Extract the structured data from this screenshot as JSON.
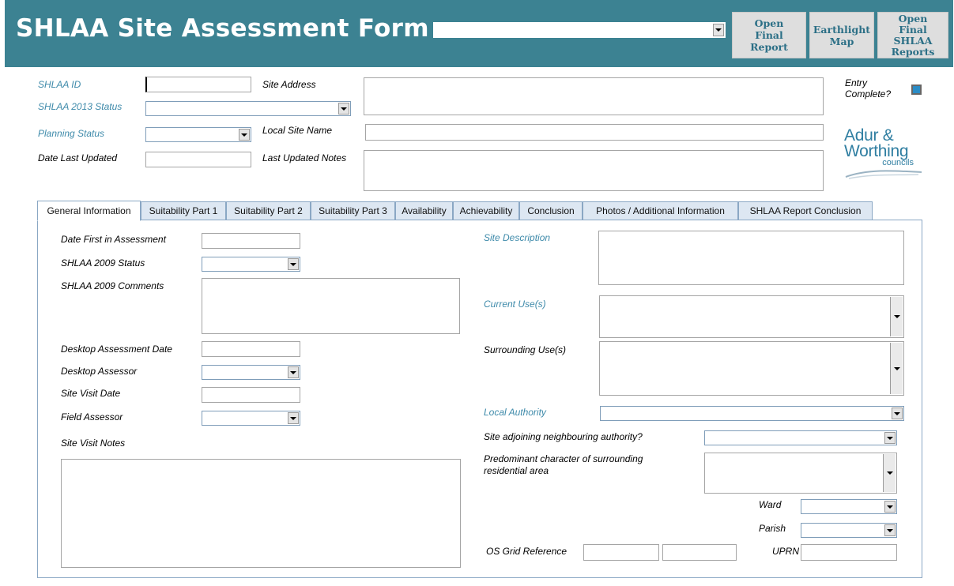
{
  "header": {
    "title": "SHLAA Site Assessment Form",
    "site_select_value": "",
    "buttons": {
      "open_final_report": "Open Final Report",
      "earthlight_map": "Earthlight Map",
      "open_final_shlaa_reports": "Open Final SHLAA Reports"
    }
  },
  "top_form": {
    "shlaa_id_label": "SHLAA ID",
    "shlaa_2013_status_label": "SHLAA 2013 Status",
    "planning_status_label": "Planning Status",
    "date_last_updated_label": "Date Last Updated",
    "site_address_label": "Site Address",
    "local_site_name_label": "Local Site Name",
    "last_updated_notes_label": "Last Updated Notes",
    "entry_complete_label": "Entry Complete?",
    "entry_complete_checked": true
  },
  "logo": {
    "line1": "Adur &",
    "line2": "Worthing",
    "line3": "councils"
  },
  "tabs": [
    {
      "label": "General Information",
      "active": true
    },
    {
      "label": "Suitability Part 1",
      "active": false
    },
    {
      "label": "Suitability Part 2",
      "active": false
    },
    {
      "label": "Suitability Part 3",
      "active": false
    },
    {
      "label": "Availability",
      "active": false
    },
    {
      "label": "Achievability",
      "active": false
    },
    {
      "label": "Conclusion",
      "active": false
    },
    {
      "label": "Photos / Additional Information",
      "active": false
    },
    {
      "label": "SHLAA Report Conclusion",
      "active": false
    }
  ],
  "general": {
    "date_first_in_assessment": "Date First in Assessment",
    "shlaa_2009_status": "SHLAA 2009 Status",
    "shlaa_2009_comments": "SHLAA 2009 Comments",
    "desktop_assessment_date": "Desktop Assessment Date",
    "desktop_assessor": "Desktop Assessor",
    "site_visit_date": "Site Visit Date",
    "field_assessor": "Field Assessor",
    "site_visit_notes": "Site Visit Notes",
    "site_description": "Site Description",
    "current_uses": "Current Use(s)",
    "surrounding_uses": "Surrounding Use(s)",
    "local_authority": "Local Authority",
    "site_adjoining": "Site adjoining neighbouring authority?",
    "predominant_character": "Predominant character of surrounding residential area",
    "ward": "Ward",
    "parish": "Parish",
    "os_grid_reference": "OS Grid Reference",
    "uprn": "UPRN"
  },
  "colors": {
    "header_bg": "#3c8292",
    "label_blue": "#3e8aaa",
    "button_text": "#2b6f86",
    "tab_bg": "#dde7f2"
  }
}
